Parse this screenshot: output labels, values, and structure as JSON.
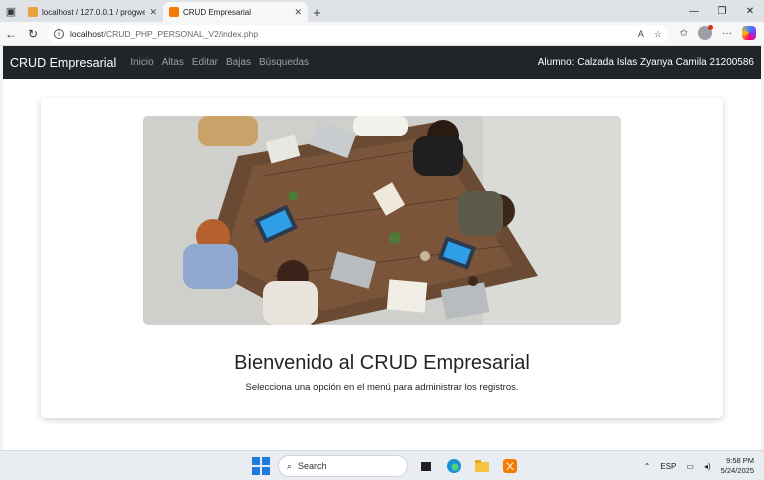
{
  "browser": {
    "tabs": [
      {
        "title": "localhost / 127.0.0.1 / progweb | p",
        "active": false
      },
      {
        "title": "CRUD Empresarial",
        "active": true
      }
    ],
    "url_host": "localhost",
    "url_path": "/CRUD_PHP_PERSONAL_V2/index.php"
  },
  "navbar": {
    "brand": "CRUD Empresarial",
    "links": [
      "Inicio",
      "Altas",
      "Editar",
      "Bajas",
      "Búsquedas"
    ],
    "student": "Alumno: Calzada Islas Zyanya Camila 21200586"
  },
  "main": {
    "welcome": "Bienvenido al CRUD Empresarial",
    "subtitle": "Selecciona una opción en el menú para administrar los registros."
  },
  "taskbar": {
    "search_placeholder": "Search",
    "lang": "ESP",
    "time": "9:58 PM",
    "date": "5/24/2025"
  },
  "colors": {
    "navbar_bg": "#212529",
    "accent": "#1f7ae0"
  }
}
